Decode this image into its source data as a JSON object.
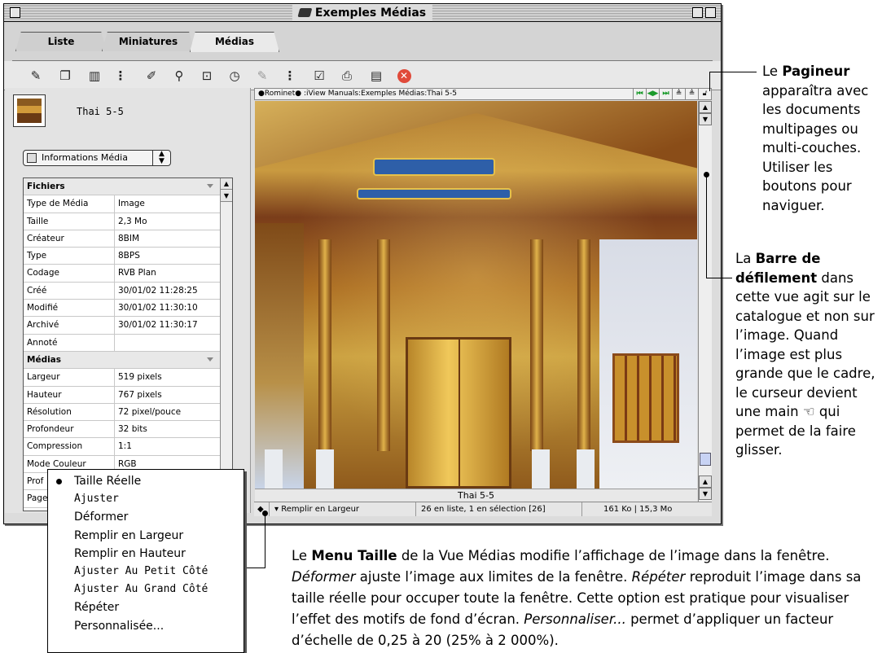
{
  "window": {
    "title": "Exemples Médias",
    "tabs": [
      "Liste",
      "Miniatures",
      "Médias"
    ],
    "active_tab": "Médias"
  },
  "toolbar": {
    "icons": [
      "stamp-icon",
      "book-icon",
      "trash-icon",
      "separator",
      "label-icon",
      "keyword-icon",
      "slideshow-icon",
      "clock-icon",
      "brush-icon",
      "separator",
      "checkbox-icon",
      "print-icon",
      "movie-icon",
      "stop-icon"
    ]
  },
  "left": {
    "thumb_name": "Thai 5-5",
    "info_menu": "Informations Média",
    "sections": [
      {
        "title": "Fichiers",
        "rows": [
          {
            "k": "Type de Média",
            "v": "Image"
          },
          {
            "k": "Taille",
            "v": "2,3 Mo"
          },
          {
            "k": "Créateur",
            "v": "8BIM"
          },
          {
            "k": "Type",
            "v": "8BPS"
          },
          {
            "k": "Codage",
            "v": "RVB Plan"
          },
          {
            "k": "Créé",
            "v": "30/01/02 11:28:25"
          },
          {
            "k": "Modifié",
            "v": "30/01/02 11:30:10"
          },
          {
            "k": "Archivé",
            "v": "30/01/02 11:30:17"
          },
          {
            "k": "Annoté",
            "v": ""
          }
        ]
      },
      {
        "title": "Médias",
        "rows": [
          {
            "k": "Largeur",
            "v": "519 pixels"
          },
          {
            "k": "Hauteur",
            "v": "767 pixels"
          },
          {
            "k": "Résolution",
            "v": "72 pixel/pouce"
          },
          {
            "k": "Profondeur",
            "v": "32 bits"
          },
          {
            "k": "Compression",
            "v": "1:1"
          },
          {
            "k": "Mode Couleur",
            "v": "RGB"
          },
          {
            "k": "Prof",
            "v": ""
          },
          {
            "k": "Page",
            "v": ""
          }
        ]
      }
    ]
  },
  "main": {
    "path": "●Rominet● :iView Manuals:Exemples Médias:Thai 5-5",
    "caption": "Thai 5-5",
    "status": {
      "size_menu": "Remplir en Largeur",
      "selection": "26 en liste, 1 en sélection [26]",
      "sizes": "161 Ko | 15,3 Mo"
    }
  },
  "popup": {
    "items": [
      "Taille Réelle",
      "Ajuster",
      "Déformer",
      "Remplir en Largeur",
      "Remplir en Hauteur",
      "Ajuster Au Petit Côté",
      "Ajuster Au Grand Côté",
      "Répéter",
      "Personnalisée..."
    ],
    "checked": "Taille Réelle"
  },
  "annotations": {
    "pager": {
      "pre": "Le ",
      "bold": "Pagineur",
      "post": " apparaîtra avec les documents multipages ou multi-couches. Utiliser les boutons pour naviguer."
    },
    "scroll": {
      "pre": "La ",
      "bold": "Barre de défilement",
      "post": " dans cette vue agit sur le catalogue et non sur l’image. Quand l’image est plus grande que le cadre, le curseur devient une main ",
      "post2": " qui permet de la faire glisser."
    },
    "menu": {
      "pre": "Le ",
      "bold": "Menu Taille",
      "p1": " de la Vue Médias modifie l’affichage de l’image dans la fenêtre. ",
      "i1": "Déformer",
      "p2": " ajuste l’image aux limites de la fenêtre. ",
      "i2": "Répéter",
      "p3": " reproduit l’image dans sa taille réelle pour occuper toute la fenêtre. Cette option est pratique pour visualiser l’effet des motifs de fond d’écran. ",
      "i3": "Personnaliser...",
      "p4": " permet d’appliquer un facteur d’échelle de 0,25 à 20 (25% à 2 000%)."
    }
  }
}
